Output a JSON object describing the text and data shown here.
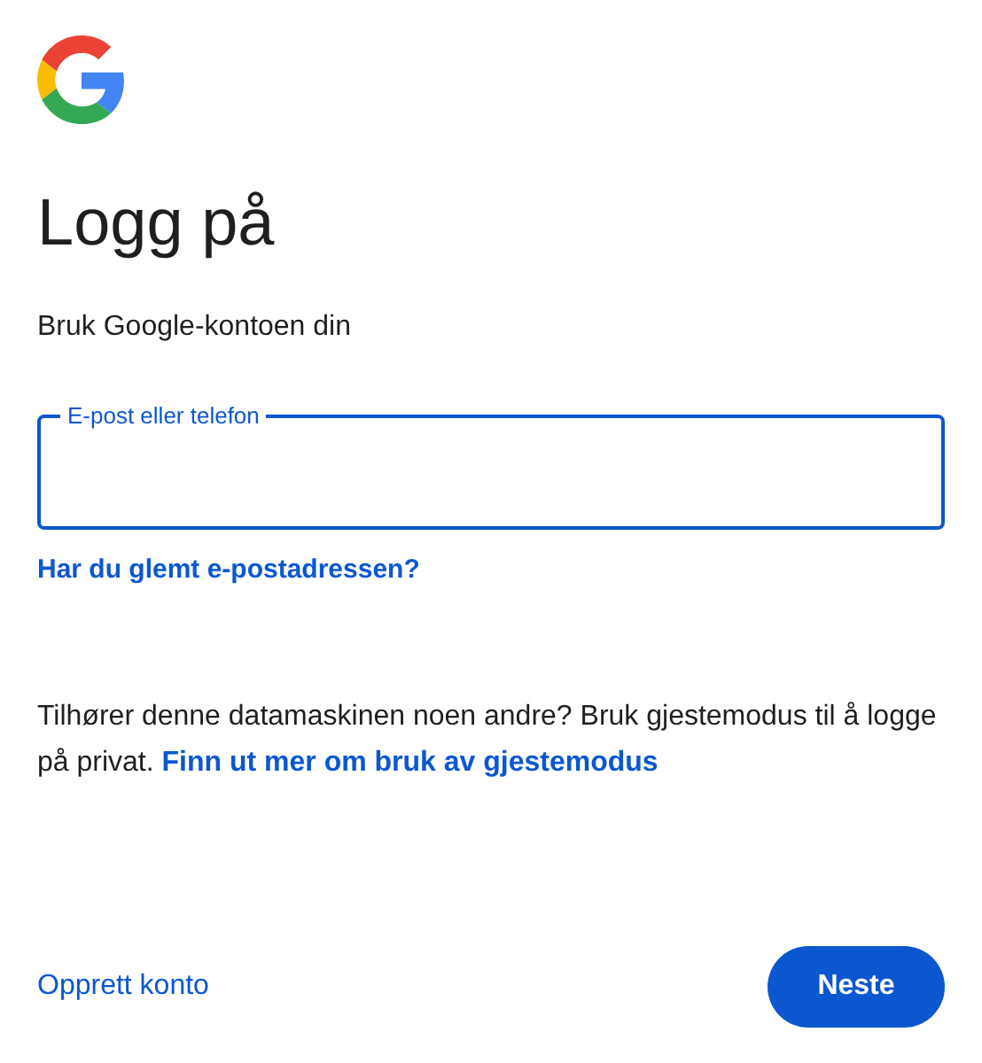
{
  "heading": "Logg på",
  "subtitle": "Bruk Google-kontoen din",
  "email_field": {
    "label": "E-post eller telefon",
    "focused": true
  },
  "forgot_link": "Har du glemt e-postadressen?",
  "guest_info": {
    "text": "Tilhører denne datamaskinen noen andre? Bruk gjestemodus til å logge på privat.",
    "link": "Finn ut mer om bruk av gjestemodus"
  },
  "create_account_link": "Opprett konto",
  "next_button": "Neste"
}
